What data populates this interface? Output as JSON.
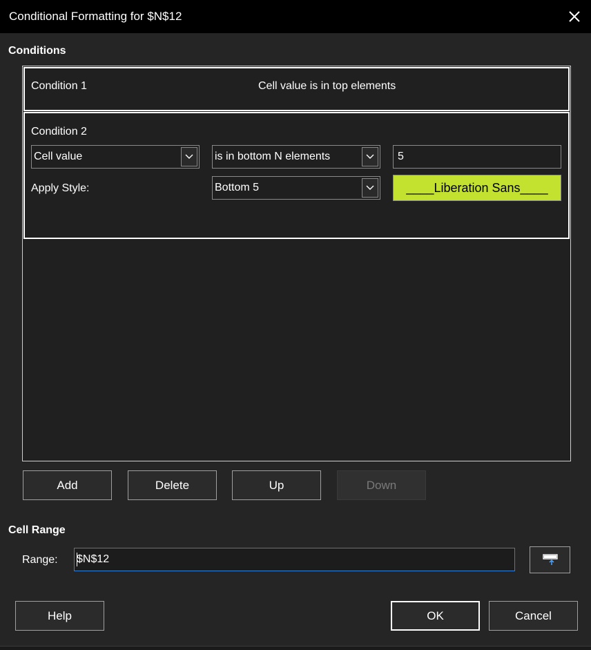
{
  "window": {
    "title": "Conditional Formatting for $N$12",
    "close_icon": "close-icon"
  },
  "conditions": {
    "heading": "Conditions",
    "condition1": {
      "label": "Condition 1",
      "summary": "Cell value is in top elements"
    },
    "condition2": {
      "label": "Condition 2",
      "type_select": "Cell value",
      "operator_select": "is in bottom N elements",
      "value": "5",
      "apply_style_label": "Apply Style:",
      "style_select": "Bottom 5",
      "preview_text": "____Liberation Sans____",
      "preview_color": "#c3e22f"
    }
  },
  "buttons": {
    "add": "Add",
    "delete": "Delete",
    "up": "Up",
    "down": "Down",
    "help": "Help",
    "ok": "OK",
    "cancel": "Cancel"
  },
  "cell_range": {
    "heading": "Cell Range",
    "range_label": "Range:",
    "range_value": "$N$12",
    "shrink_icon": "shrink-icon"
  },
  "colors": {
    "background": "#252525",
    "titlebar": "#000000",
    "focus_border": "#2f7fd4"
  }
}
